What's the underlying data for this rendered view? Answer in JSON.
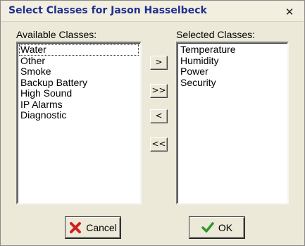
{
  "window": {
    "title": "Select Classes for Jason Hasselbeck",
    "close_glyph": "✕"
  },
  "available": {
    "label": "Available Classes:",
    "items": [
      "Water",
      "Other",
      "Smoke",
      "Backup Battery",
      "High Sound",
      "IP Alarms",
      "Diagnostic"
    ]
  },
  "selected": {
    "label": "Selected Classes:",
    "items": [
      "Temperature",
      "Humidity",
      "Power",
      "Security"
    ]
  },
  "move_buttons": {
    "add_one": ">",
    "add_all": ">>",
    "remove_one": "<",
    "remove_all": "<<"
  },
  "buttons": {
    "cancel": {
      "label": "Cancel",
      "icon": "red-x-icon",
      "icon_color": "#d11f1f"
    },
    "ok": {
      "label": "OK",
      "icon": "green-checkmark-icon",
      "icon_color": "#2e9a2e"
    }
  }
}
